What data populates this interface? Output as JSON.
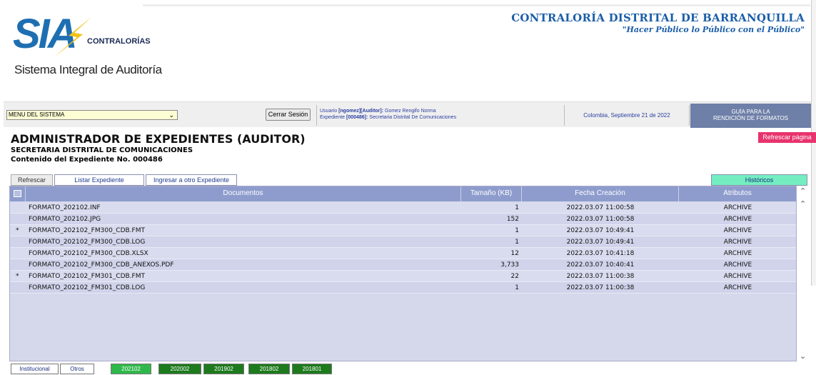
{
  "logo": {
    "mark": "SIA",
    "brand": "CONTRALORÍAS",
    "subtitle": "Sistema Integral de Auditoría"
  },
  "org": {
    "name": "CONTRALORÍA DISTRITAL DE BARRANQUILLA",
    "motto": "\"Hacer Público lo Público con el Público\""
  },
  "toolbar": {
    "menu_value": "MENU DEL SISTEMA",
    "logout_label": "Cerrar Sesión",
    "user_prefix": "Usuario",
    "user_id": "[ngomez][Auditor]:",
    "user_name": "Gomez Rengifo Norma",
    "file_prefix": "Expediente",
    "file_id": "[000486]:",
    "file_name": "Secretaria Distrital De Comunicaciones",
    "date": "Colombia, Septiembre 21 de 2022",
    "guide_line1": "GUÍA PARA LA",
    "guide_line2": "RENDICIÓN DE FORMATOS",
    "refresh_page": "Refrescar página"
  },
  "page": {
    "title": "ADMINISTRADOR DE EXPEDIENTES (AUDITOR)",
    "subtitle": "SECRETARIA DISTRITAL DE COMUNICACIONES",
    "content_title": "Contenido del Expediente No. 000486"
  },
  "tabs": {
    "refresh": "Refrescar",
    "list": "Listar Expediente",
    "other": "Ingresar a otro Expediente",
    "history": "Históricos"
  },
  "table": {
    "columns": [
      "Documentos",
      "Tamaño (KB)",
      "Fecha Creación",
      "Atributos"
    ],
    "rows": [
      {
        "mark": "",
        "name": "FORMATO_202102.INF",
        "size": "1",
        "date": "2022.03.07 11:00:58",
        "attr": "ARCHIVE"
      },
      {
        "mark": "",
        "name": "FORMATO_202102.JPG",
        "size": "152",
        "date": "2022.03.07 11:00:58",
        "attr": "ARCHIVE"
      },
      {
        "mark": "*",
        "name": "FORMATO_202102_FM300_CDB.FMT",
        "size": "1",
        "date": "2022.03.07 10:49:41",
        "attr": "ARCHIVE"
      },
      {
        "mark": "",
        "name": "FORMATO_202102_FM300_CDB.LOG",
        "size": "1",
        "date": "2022.03.07 10:49:41",
        "attr": "ARCHIVE"
      },
      {
        "mark": "",
        "name": "FORMATO_202102_FM300_CDB.XLSX",
        "size": "12",
        "date": "2022.03.07 10:41:18",
        "attr": "ARCHIVE"
      },
      {
        "mark": "",
        "name": "FORMATO_202102_FM300_CDB_ANEXOS.PDF",
        "size": "3,733",
        "date": "2022.03.07 10:40:41",
        "attr": "ARCHIVE"
      },
      {
        "mark": "*",
        "name": "FORMATO_202102_FM301_CDB.FMT",
        "size": "22",
        "date": "2022.03.07 11:00:38",
        "attr": "ARCHIVE"
      },
      {
        "mark": "",
        "name": "FORMATO_202102_FM301_CDB.LOG",
        "size": "1",
        "date": "2022.03.07 11:00:38",
        "attr": "ARCHIVE"
      }
    ]
  },
  "bottom_tabs": [
    "Institucional",
    "Otros",
    "202102",
    "202002",
    "201902",
    "201802",
    "201801"
  ],
  "colors": {
    "header_blue": "#8e9ccd",
    "accent_pink": "#e8336d",
    "history_green": "#74eec1",
    "period_green": "#1d7a1d",
    "selected_green": "#2fb84a"
  }
}
